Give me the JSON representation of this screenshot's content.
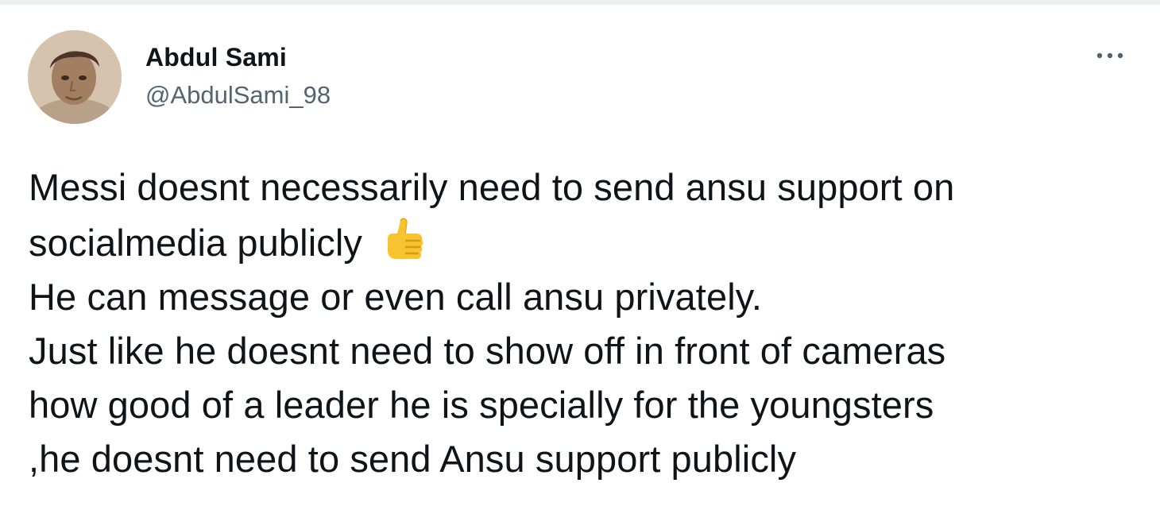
{
  "tweet": {
    "author": {
      "name": "Abdul Sami",
      "handle": "@AbdulSami_98",
      "avatar_icon": "profile-photo"
    },
    "more_icon": "more-horizontal-icon",
    "lines": [
      {
        "text": "Messi doesnt necessarily need to send ansu support on",
        "emoji": null
      },
      {
        "text": "socialmedia publicly",
        "emoji": "thumbs-up"
      },
      {
        "text": "He can message or even call ansu privately.",
        "emoji": null
      },
      {
        "text": "Just like he doesnt need to show off in front of cameras",
        "emoji": null
      },
      {
        "text": "how good of a leader he is specially for the youngsters",
        "emoji": null
      },
      {
        "text": ",he doesnt need to send Ansu support publicly",
        "emoji": null
      }
    ]
  },
  "colors": {
    "text_primary": "#0f1419",
    "text_secondary": "#536471",
    "emoji_yellow": "#f7c32e"
  }
}
